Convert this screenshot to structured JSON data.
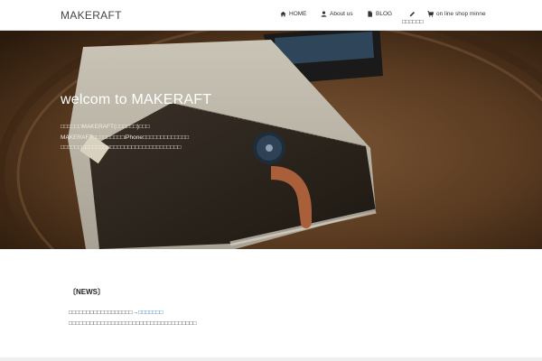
{
  "header": {
    "logo": "MAKERAFT",
    "nav": [
      {
        "label": "HOME",
        "icon": "home-icon"
      },
      {
        "label": "About us",
        "icon": "user-icon"
      },
      {
        "label": "BLOG",
        "icon": "document-icon"
      },
      {
        "label": "□□□□□□",
        "icon": "pencil-icon"
      },
      {
        "label": "on line shop minne",
        "icon": "cart-icon"
      }
    ]
  },
  "hero": {
    "title": "welcom to MAKERAFT",
    "lines": [
      "□□□□□□MAKERAFT(□□□□□□)□□□",
      "MAKERAFT□□□□□□□□□iPhone□□□□□□□□□□□□□",
      "□□□□□□□□□□□□□□□□□□□□□□□□□□□□□□□□□□"
    ]
  },
  "news": {
    "title": "〔NEWS〕",
    "line1_text": "□□□□□□□□□□□□□□□□□□→",
    "line1_link": "□□□□□□□",
    "line2": "□□□□□□□□□□□□□□□□□□□□□□□□□□□□□□□□□□□□"
  },
  "colors": {
    "link": "#2a6fb8",
    "hero_text": "#ffffff"
  }
}
